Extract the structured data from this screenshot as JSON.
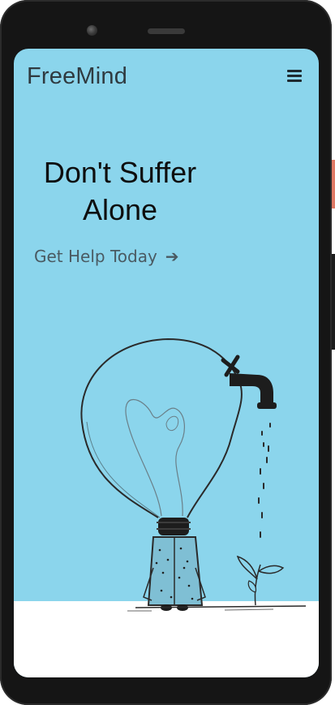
{
  "app": {
    "brand": "FreeMind",
    "menu_icon": "hamburger-menu-icon"
  },
  "hero": {
    "headline_line1": "Don't Suffer",
    "headline_line2": "Alone",
    "cta_label": "Get Help Today",
    "cta_arrow": "➔"
  },
  "illustration": {
    "description_icon": "lightbulb-with-faucet-watering-plant-icon"
  },
  "colors": {
    "screen_background": "#8bd5ec",
    "floor": "#ffffff",
    "text_dark": "#0e0e0e",
    "cta_text": "#4a5a62"
  }
}
